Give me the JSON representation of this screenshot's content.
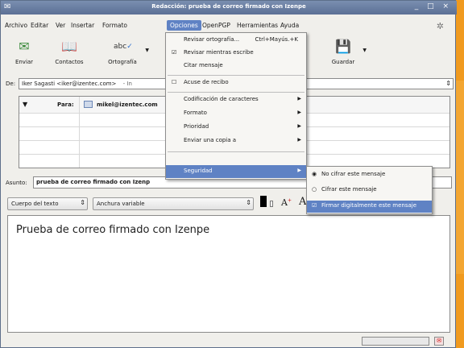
{
  "window": {
    "title": "Redacción: prueba de correo firmado con Izenpe",
    "controls": "_ □ ×"
  },
  "menubar": [
    {
      "id": "archivo",
      "label": "Archivo"
    },
    {
      "id": "editar",
      "label": "Editar"
    },
    {
      "id": "ver",
      "label": "Ver"
    },
    {
      "id": "insertar",
      "label": "Insertar"
    },
    {
      "id": "formato",
      "label": "Formato"
    },
    {
      "id": "opciones",
      "label": "Opciones"
    },
    {
      "id": "openpgp",
      "label": "OpenPGP"
    },
    {
      "id": "herramientas",
      "label": "Herramientas"
    },
    {
      "id": "ayuda",
      "label": "Ayuda"
    }
  ],
  "toolbar": {
    "enviar": "Enviar",
    "contactos": "Contactos",
    "ortografia": "Ortografía",
    "guardar": "Guardar"
  },
  "from": {
    "label": "De:",
    "value": "Iker Sagasti <iker@izentec.com>",
    "extra": "- In"
  },
  "recipients": {
    "type_label": "Para:",
    "address": "mikel@izentec.com"
  },
  "subject": {
    "label": "Asunto:",
    "value": "prueba de correo firmado con Izenp"
  },
  "format": {
    "paragraph": "Cuerpo del texto",
    "font": "Anchura variable"
  },
  "body": {
    "text": "Prueba de correo firmado con Izenpe"
  },
  "opciones_menu": {
    "ortografia": "Revisar ortografía...",
    "ortografia_shortcut": "Ctrl+Mayús.+K",
    "revisar_escribe": "Revisar mientras escribe",
    "citar": "Citar mensaje",
    "acuse": "Acuse de recibo",
    "codificacion": "Codificación de caracteres",
    "formato": "Formato",
    "prioridad": "Prioridad",
    "enviar_copia": "Enviar una copia a",
    "seguridad": "Seguridad"
  },
  "seguridad_menu": {
    "no_cifrar": "No cifrar este mensaje",
    "cifrar": "Cifrar este mensaje",
    "firmar": "Firmar digitalmente este mensaje"
  },
  "colors": {
    "accent": "#5f82c4",
    "titlebar": "#5b6f95",
    "orange": "#f09a1f"
  }
}
